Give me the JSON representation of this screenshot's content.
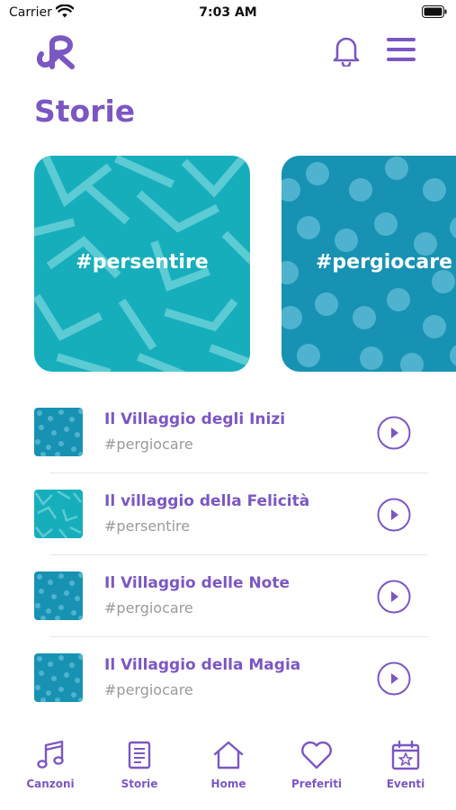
{
  "status_bar": {
    "carrier": "Carrier",
    "time": "7:03 AM"
  },
  "page": {
    "title": "Storie"
  },
  "featured": [
    {
      "label": "#persentire",
      "color": "#17AEBC",
      "pattern": "zigzag"
    },
    {
      "label": "#pergiocare",
      "color": "#1792B3",
      "pattern": "dots"
    }
  ],
  "stories": [
    {
      "title": "Il Villaggio degli Inizi",
      "tag": "#pergiocare",
      "thumb": "dots"
    },
    {
      "title": "Il villaggio della Felicità",
      "tag": "#persentire",
      "thumb": "zigzag"
    },
    {
      "title": "Il Villaggio delle Note",
      "tag": "#pergiocare",
      "thumb": "dots"
    },
    {
      "title": "Il Villaggio della Magia",
      "tag": "#pergiocare",
      "thumb": "dots"
    }
  ],
  "tabs": [
    {
      "label": "Canzoni",
      "icon": "music-note-icon"
    },
    {
      "label": "Storie",
      "icon": "document-icon"
    },
    {
      "label": "Home",
      "icon": "home-icon"
    },
    {
      "label": "Preferiti",
      "icon": "heart-icon"
    },
    {
      "label": "Eventi",
      "icon": "calendar-star-icon"
    }
  ],
  "colors": {
    "accent": "#7B57C2",
    "teal": "#17AEBC",
    "blue": "#1792B3"
  }
}
